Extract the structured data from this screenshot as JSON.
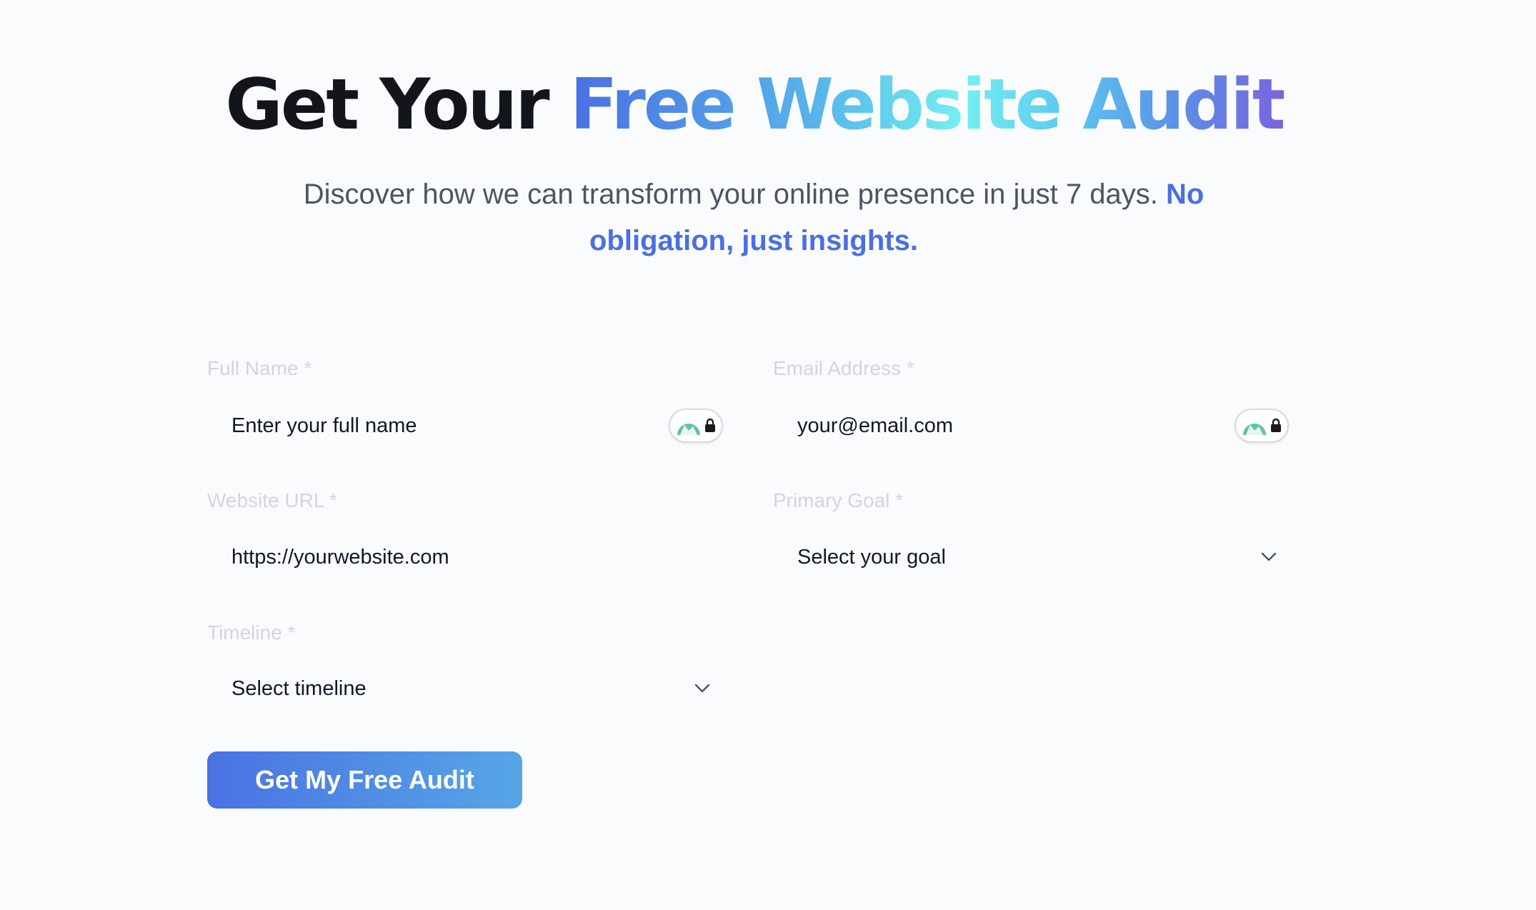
{
  "hero": {
    "title_dark": "Get Your ",
    "title_gradient": "Free Website Audit",
    "subtitle_plain": "Discover how we can transform your online presence in just 7 days. ",
    "subtitle_accent": "No obligation, just insights."
  },
  "form": {
    "full_name": {
      "label": "Full Name *",
      "placeholder": "Enter your full name"
    },
    "email": {
      "label": "Email Address *",
      "placeholder": "your@email.com"
    },
    "website": {
      "label": "Website URL *",
      "placeholder": "https://yourwebsite.com"
    },
    "goal": {
      "label": "Primary Goal *",
      "selected": "Select your goal"
    },
    "timeline": {
      "label": "Timeline *",
      "selected": "Select timeline"
    },
    "submit_label": "Get My Free Audit"
  },
  "icons": {
    "password_manager": "password-manager-icon",
    "chevron": "chevron-down-icon"
  },
  "colors": {
    "accent": "#4a6fe3",
    "title_dark": "#12161c",
    "label": "#d2d6dc",
    "subtitle": "#4b5563"
  }
}
